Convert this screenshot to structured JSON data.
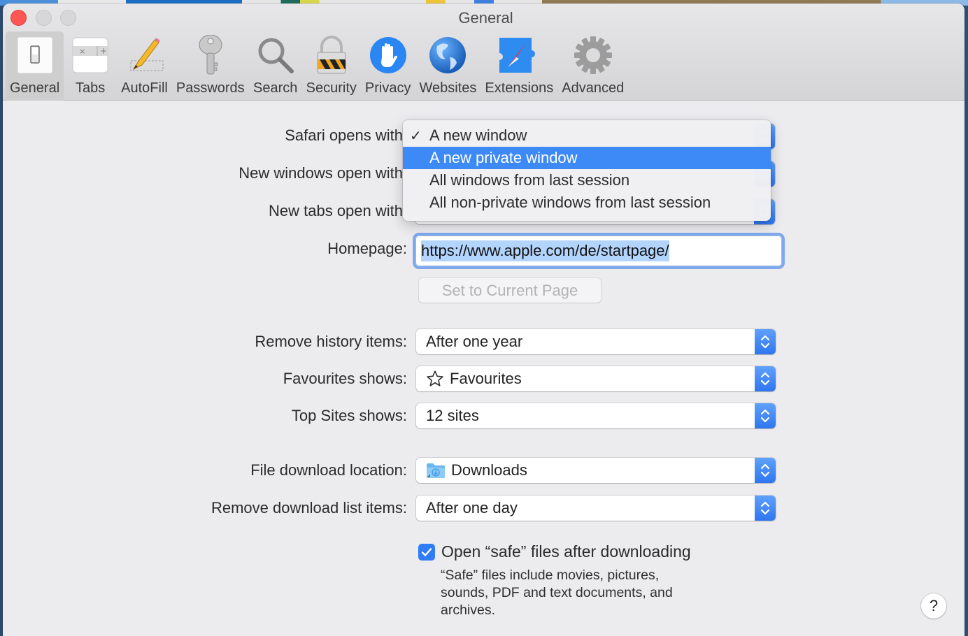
{
  "window": {
    "title": "General"
  },
  "toolbar": {
    "items": [
      {
        "label": "General",
        "icon": "general-switch-icon",
        "selected": true
      },
      {
        "label": "Tabs",
        "icon": "tabs-icon",
        "selected": false
      },
      {
        "label": "AutoFill",
        "icon": "pencil-icon",
        "selected": false
      },
      {
        "label": "Passwords",
        "icon": "key-icon",
        "selected": false
      },
      {
        "label": "Search",
        "icon": "magnifier-icon",
        "selected": false
      },
      {
        "label": "Security",
        "icon": "padlock-icon",
        "selected": false
      },
      {
        "label": "Privacy",
        "icon": "hand-icon",
        "selected": false
      },
      {
        "label": "Websites",
        "icon": "globe-icon",
        "selected": false
      },
      {
        "label": "Extensions",
        "icon": "puzzle-compass-icon",
        "selected": false
      },
      {
        "label": "Advanced",
        "icon": "gear-icon",
        "selected": false
      }
    ]
  },
  "settings": {
    "safari_opens_with": {
      "label": "Safari opens with",
      "menu_open": true,
      "options": [
        {
          "label": "A new window",
          "checked": true,
          "highlighted": false
        },
        {
          "label": "A new private window",
          "checked": false,
          "highlighted": true
        },
        {
          "label": "All windows from last session",
          "checked": false,
          "highlighted": false
        },
        {
          "label": "All non-private windows from last session",
          "checked": false,
          "highlighted": false
        }
      ],
      "check_glyph": "✓"
    },
    "new_windows_open_with": {
      "label": "New windows open with"
    },
    "new_tabs_open_with": {
      "label": "New tabs open with"
    },
    "homepage": {
      "label": "Homepage:",
      "value": "https://www.apple.com/de/startpage/"
    },
    "set_current_page": {
      "label": "Set to Current Page",
      "enabled": false
    },
    "remove_history": {
      "label": "Remove history items:",
      "value": "After one year"
    },
    "favourites_shows": {
      "label": "Favourites shows:",
      "value": "Favourites",
      "icon": "star-icon"
    },
    "top_sites_shows": {
      "label": "Top Sites shows:",
      "value": "12 sites"
    },
    "download_location": {
      "label": "File download location:",
      "value": "Downloads",
      "icon": "downloads-folder-icon"
    },
    "remove_download_items": {
      "label": "Remove download list items:",
      "value": "After one day"
    },
    "open_safe_files": {
      "label": "Open “safe” files after downloading",
      "checked": true,
      "help": "“Safe” files include movies, pictures, sounds, PDF and text documents, and archives."
    },
    "help_button": {
      "label": "?"
    }
  },
  "colors": {
    "accent": "#2f7cf6",
    "menu_highlight": "#3d8af7",
    "close_button": "#fc5753",
    "window_bg": "#ecebee"
  }
}
